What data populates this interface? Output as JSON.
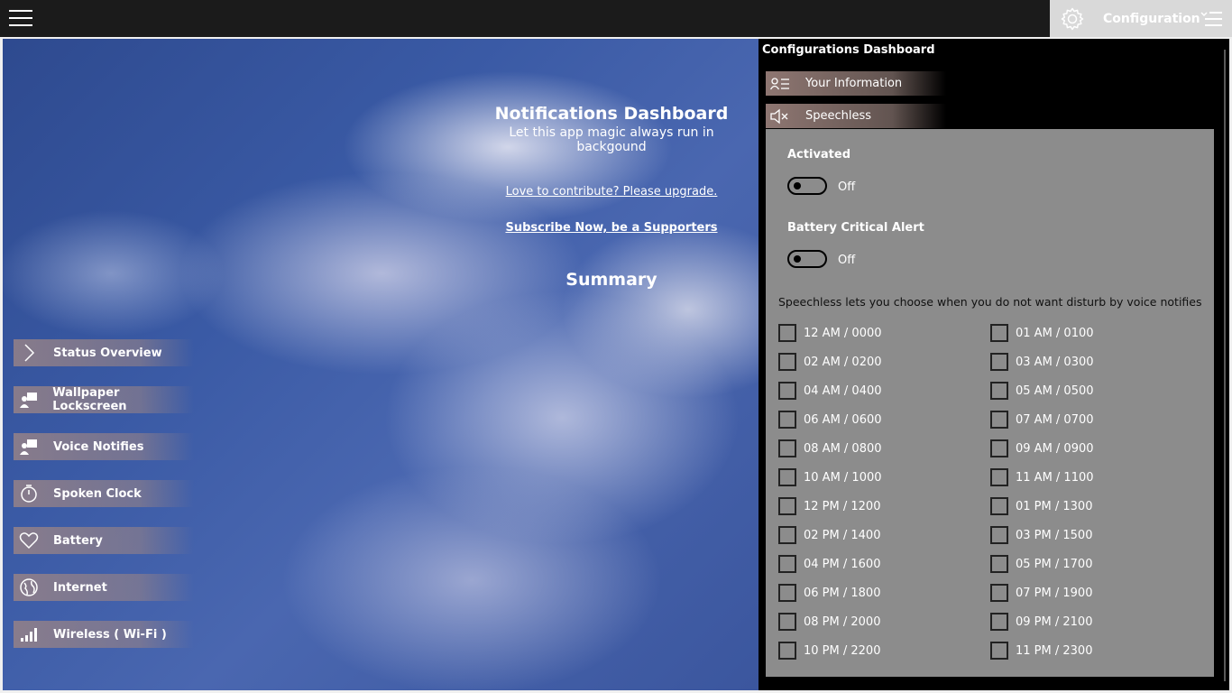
{
  "header": {
    "config_label": "Configuration"
  },
  "notifications": {
    "title": "Notifications Dashboard",
    "subtitle": "Let this app magic always run in backgound",
    "contribute_link": "Love to contribute? Please upgrade.",
    "subscribe_link": "Subscribe Now, be a Supporters",
    "summary": "Summary"
  },
  "nav": {
    "items": [
      {
        "label": "Status Overview",
        "icon": "chevron-right-icon"
      },
      {
        "label": "Wallpaper Lockscreen",
        "icon": "picture-person-icon"
      },
      {
        "label": "Voice Notifies",
        "icon": "picture-person-icon"
      },
      {
        "label": "Spoken Clock",
        "icon": "stopwatch-icon"
      },
      {
        "label": "Battery",
        "icon": "heart-icon"
      },
      {
        "label": "Internet",
        "icon": "globe-icon"
      },
      {
        "label": "Wireless ( Wi-Fi )",
        "icon": "signal-bars-icon"
      }
    ]
  },
  "panel": {
    "title": "Configurations Dashboard",
    "tabs": [
      {
        "label": "Your Information",
        "icon": "contact-card-icon"
      },
      {
        "label": "Speechless",
        "icon": "mute-icon"
      }
    ],
    "activated": {
      "label": "Activated",
      "state": "Off"
    },
    "battery_alert": {
      "label": "Battery Critical Alert",
      "state": "Off"
    },
    "description": "Speechless lets you choose when you do not want disturb by voice notifies",
    "hours": [
      "12 AM / 0000",
      "01 AM / 0100",
      "02 AM / 0200",
      "03 AM / 0300",
      "04 AM / 0400",
      "05 AM / 0500",
      "06 AM / 0600",
      "07 AM / 0700",
      "08 AM / 0800",
      "09 AM / 0900",
      "10 AM / 1000",
      "11 AM / 1100",
      "12 PM / 1200",
      "01 PM / 1300",
      "02 PM / 1400",
      "03 PM / 1500",
      "04 PM / 1600",
      "05 PM / 1700",
      "06 PM / 1800",
      "07 PM / 1900",
      "08 PM / 2000",
      "09 PM / 2100",
      "10 PM / 2200",
      "11 PM / 2300"
    ]
  }
}
